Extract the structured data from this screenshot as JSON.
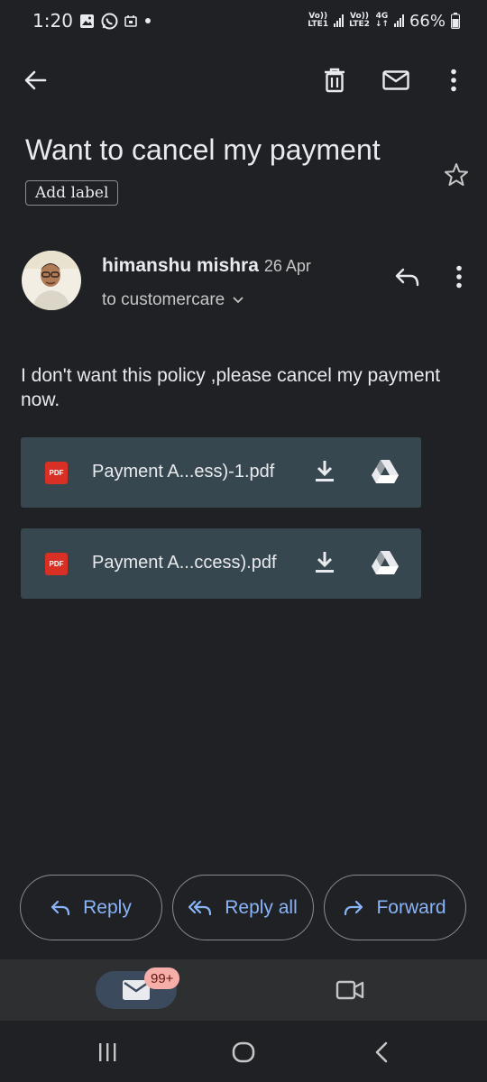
{
  "status_bar": {
    "time": "1:20",
    "sim1_top": "Vo))",
    "sim1_bottom": "LTE1",
    "sim2_top": "Vo))",
    "sim2_bottom": "LTE2",
    "network": "4G",
    "battery": "66%"
  },
  "email": {
    "subject": "Want to cancel my payment",
    "label_button": "Add label",
    "sender_name": "himanshu mishra",
    "date": "26 Apr",
    "recipient": "to customercare",
    "body": "I don't want this policy ,please cancel my payment now."
  },
  "attachments": [
    {
      "type_label": "PDF",
      "filename": "Payment A...ess)-1.pdf"
    },
    {
      "type_label": "PDF",
      "filename": "Payment A...ccess).pdf"
    }
  ],
  "actions": {
    "reply": "Reply",
    "reply_all": "Reply all",
    "forward": "Forward"
  },
  "bottom_nav": {
    "mail_badge": "99+"
  },
  "colors": {
    "background": "#1f2124",
    "accent": "#8ab4f8",
    "attachment_bg": "#37474f",
    "pdf_red": "#d93025"
  }
}
